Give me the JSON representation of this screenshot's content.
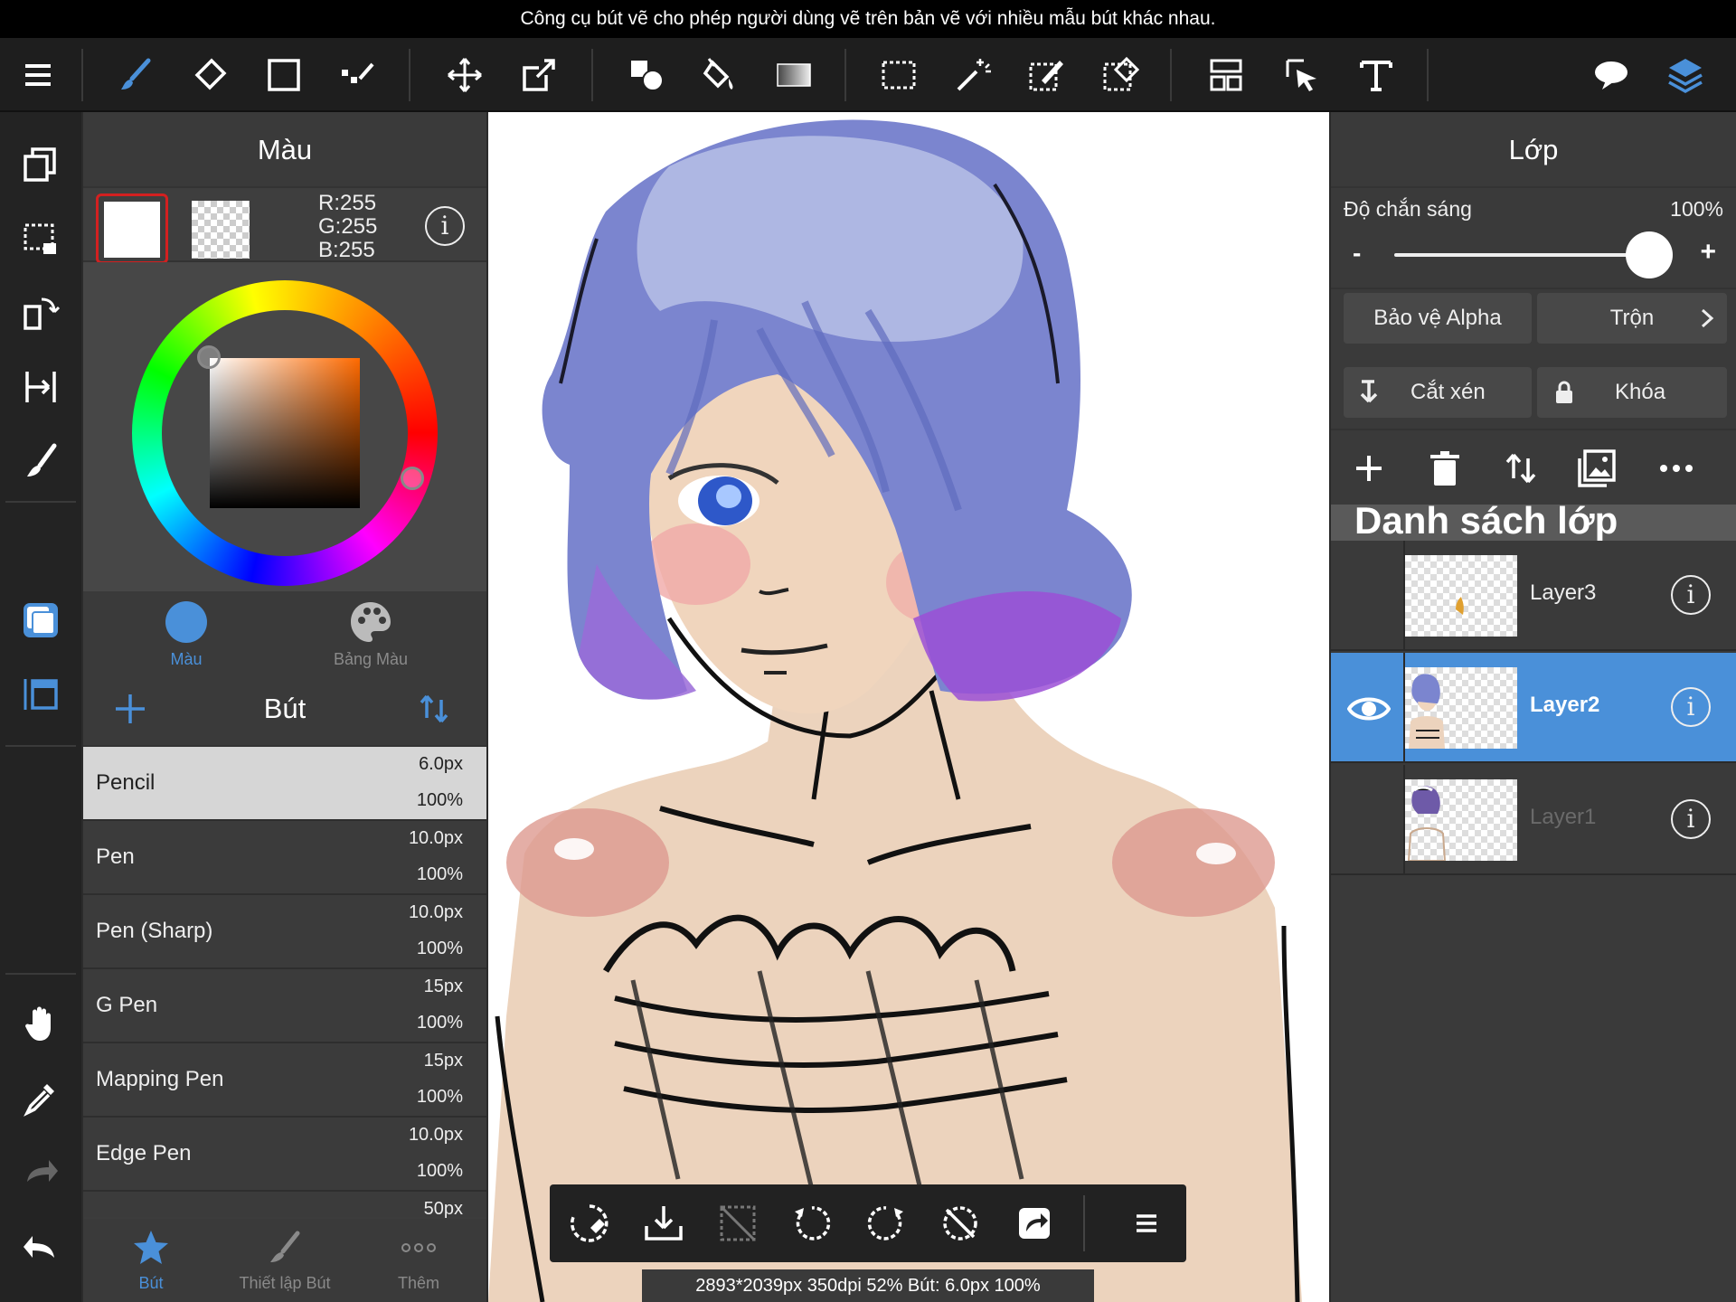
{
  "caption": "Công cụ bút vẽ cho phép người dùng vẽ trên bản vẽ với nhiều mẫu bút khác nhau.",
  "color_panel": {
    "title": "Màu",
    "rgb": {
      "r": "R:255",
      "g": "G:255",
      "b": "B:255"
    },
    "tabs": [
      {
        "label": "Màu"
      },
      {
        "label": "Bảng Màu"
      }
    ]
  },
  "brush_panel": {
    "title": "Bút",
    "items": [
      {
        "name": "Pencil",
        "size": "6.0px",
        "opacity": "100%"
      },
      {
        "name": "Pen",
        "size": "10.0px",
        "opacity": "100%"
      },
      {
        "name": "Pen (Sharp)",
        "size": "10.0px",
        "opacity": "100%"
      },
      {
        "name": "G Pen",
        "size": "15px",
        "opacity": "100%"
      },
      {
        "name": "Mapping Pen",
        "size": "15px",
        "opacity": "100%"
      },
      {
        "name": "Edge Pen",
        "size": "10.0px",
        "opacity": "100%"
      },
      {
        "name": "",
        "size": "50px",
        "opacity": ""
      }
    ],
    "footer_tabs": [
      {
        "label": "Bút"
      },
      {
        "label": "Thiết lập Bút"
      },
      {
        "label": "Thêm"
      }
    ]
  },
  "status": "2893*2039px 350dpi 52% Bút: 6.0px 100%",
  "layer_panel": {
    "title": "Lớp",
    "opacity_label": "Độ chắn sáng",
    "opacity_value": "100%",
    "minus": "-",
    "plus": "+",
    "alpha_protect": "Bảo vệ Alpha",
    "blend": "Trộn",
    "clip": "Cắt xén",
    "lock": "Khóa",
    "list_title": "Danh sách lớp",
    "layers": [
      {
        "name": "Layer3"
      },
      {
        "name": "Layer2"
      },
      {
        "name": "Layer1"
      }
    ]
  },
  "colors": {
    "accent": "#4a90d9",
    "selected_swatch_border": "#d32020"
  }
}
